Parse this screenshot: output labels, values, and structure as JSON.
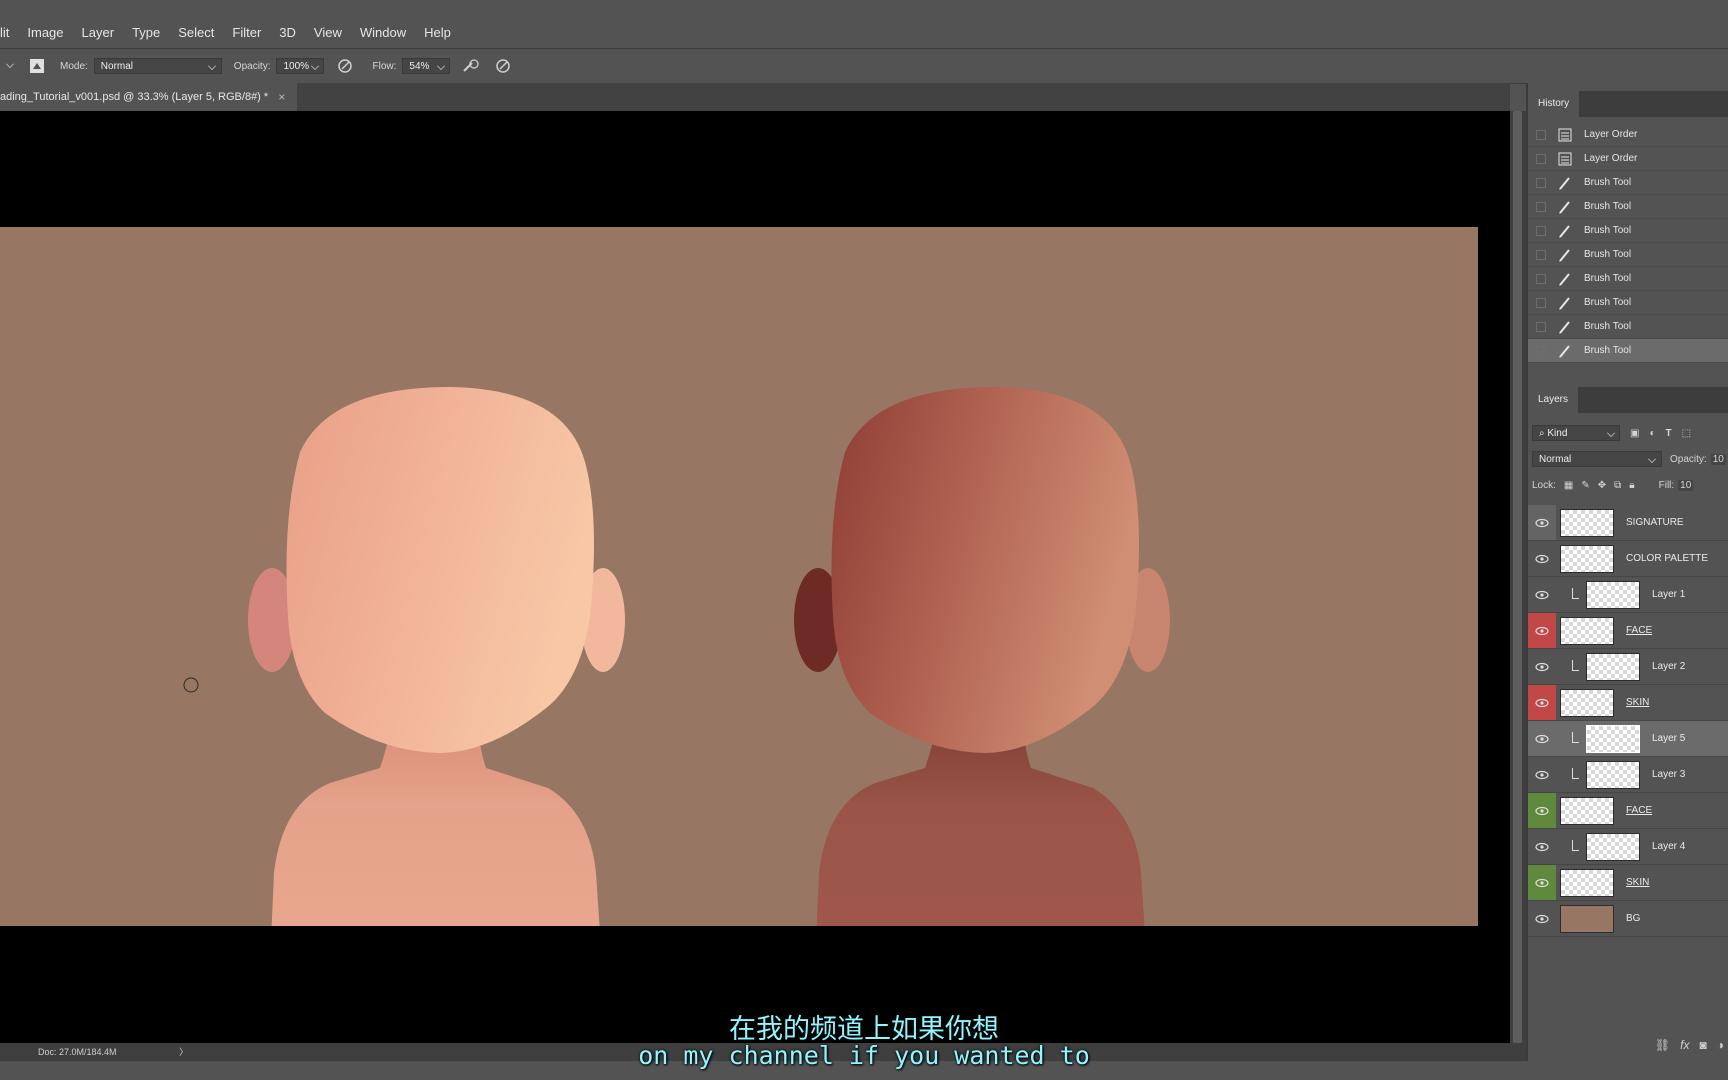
{
  "menu": [
    "lit",
    "Image",
    "Layer",
    "Type",
    "Select",
    "Filter",
    "3D",
    "View",
    "Window",
    "Help"
  ],
  "options": {
    "mode_label": "Mode:",
    "mode_value": "Normal",
    "opacity_label": "Opacity:",
    "opacity_value": "100%",
    "flow_label": "Flow:",
    "flow_value": "54%"
  },
  "doc_tab": {
    "title": "ading_Tutorial_v001.psd @ 33.3% (Layer 5, RGB/8#) *",
    "close": "×"
  },
  "status": {
    "doc": "Doc: 27.0M/184.4M",
    "arrow": "〉"
  },
  "history": {
    "tab": "History",
    "items": [
      {
        "label": "Layer Order",
        "icon": "document-icon"
      },
      {
        "label": "Layer Order",
        "icon": "document-icon"
      },
      {
        "label": "Brush Tool",
        "icon": "brush-icon"
      },
      {
        "label": "Brush Tool",
        "icon": "brush-icon"
      },
      {
        "label": "Brush Tool",
        "icon": "brush-icon"
      },
      {
        "label": "Brush Tool",
        "icon": "brush-icon"
      },
      {
        "label": "Brush Tool",
        "icon": "brush-icon"
      },
      {
        "label": "Brush Tool",
        "icon": "brush-icon"
      },
      {
        "label": "Brush Tool",
        "icon": "brush-icon"
      },
      {
        "label": "Brush Tool",
        "icon": "brush-icon",
        "selected": true
      }
    ]
  },
  "layers_panel": {
    "tab": "Layers",
    "kind_label": "Kind",
    "blend_mode": "Normal",
    "opacity_label": "Opacity:",
    "opacity_value": "10",
    "lock_label": "Lock:",
    "fill_label": "Fill:",
    "fill_value": "10",
    "layers": [
      {
        "name": "SIGNATURE",
        "eye": "grey",
        "clipped": false,
        "underline": false
      },
      {
        "name": "COLOR PALETTE",
        "eye": "none",
        "clipped": false,
        "underline": false
      },
      {
        "name": "Layer 1",
        "eye": "none",
        "clipped": true,
        "underline": false
      },
      {
        "name": "FACE",
        "eye": "red",
        "clipped": false,
        "underline": true
      },
      {
        "name": "Layer 2",
        "eye": "none",
        "clipped": true,
        "underline": false
      },
      {
        "name": "SKIN",
        "eye": "red",
        "clipped": false,
        "underline": true
      },
      {
        "name": "Layer 5",
        "eye": "none",
        "clipped": true,
        "underline": false,
        "selected": true
      },
      {
        "name": "Layer 3",
        "eye": "none",
        "clipped": true,
        "underline": false
      },
      {
        "name": "FACE",
        "eye": "green",
        "clipped": false,
        "underline": true
      },
      {
        "name": "Layer 4",
        "eye": "none",
        "clipped": true,
        "underline": false
      },
      {
        "name": "SKIN",
        "eye": "green",
        "clipped": false,
        "underline": true
      },
      {
        "name": "BG",
        "eye": "none",
        "clipped": false,
        "underline": false,
        "solid": "#977764"
      }
    ]
  },
  "subtitles": {
    "cn": "在我的频道上如果你想",
    "en": "on my channel if you wanted to"
  },
  "colors": {
    "canvas_bg": "#977764",
    "light_skin": [
      "#8a4a44",
      "#c47a6c",
      "#dca08e",
      "#ecbaa3",
      "#f7d2b4"
    ],
    "dark_skin": [
      "#5a211c",
      "#7a3a32",
      "#8f4e44",
      "#a6665a",
      "#d7967c"
    ]
  }
}
